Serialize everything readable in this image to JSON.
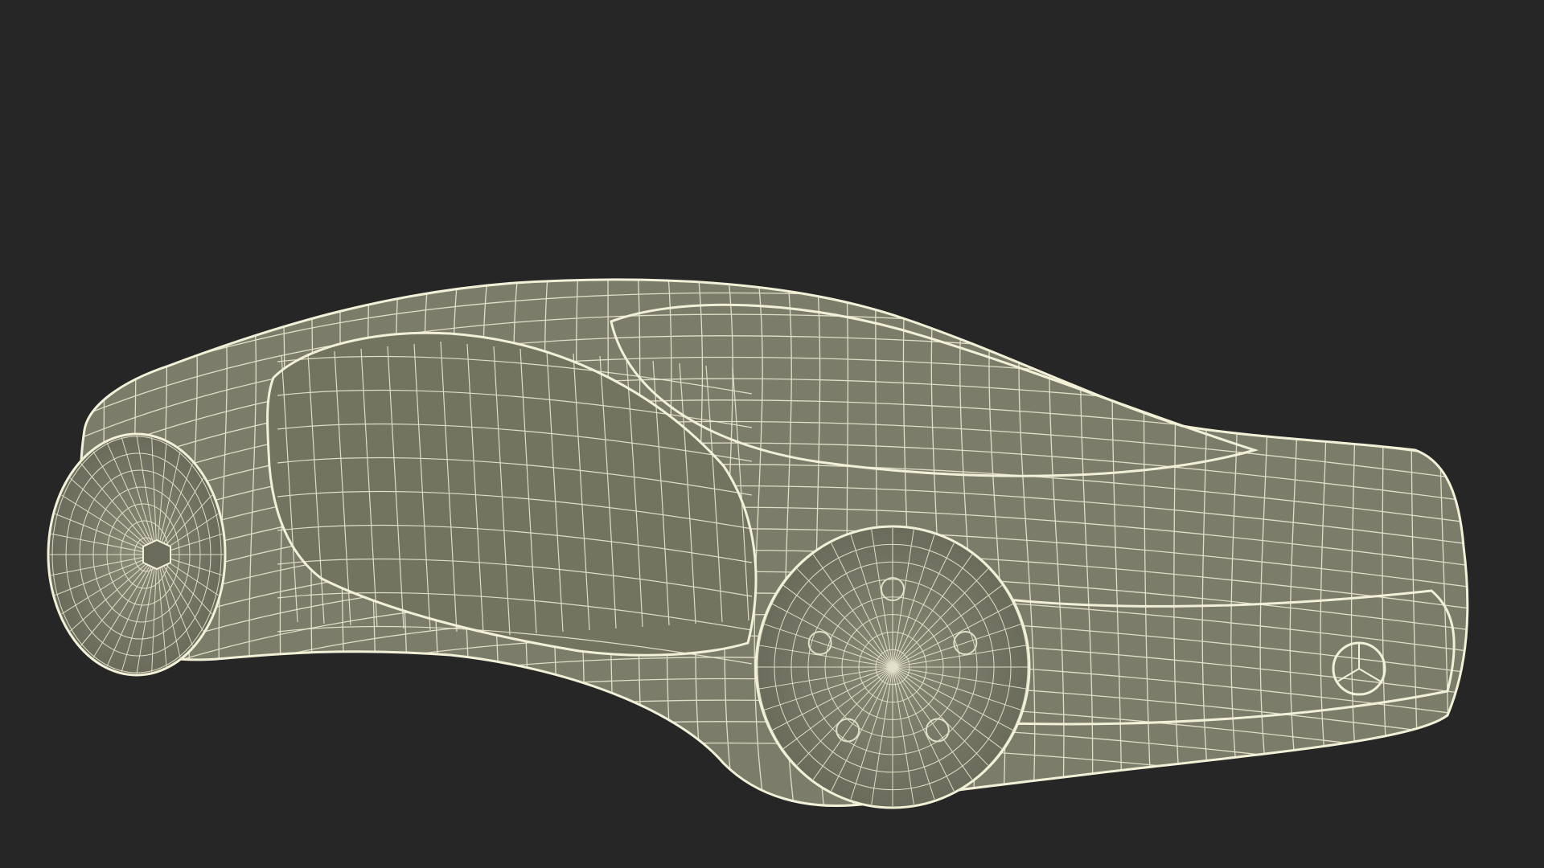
{
  "scene": {
    "subject": "wireframe-car-model",
    "colors": {
      "background": "#262626",
      "surface": "#7b7c6a",
      "surface_dark": "#6a6b5b",
      "surface_light": "#8a8b78",
      "wire": "#f3f0d8",
      "wire_soft": "#e8e4c8"
    }
  }
}
